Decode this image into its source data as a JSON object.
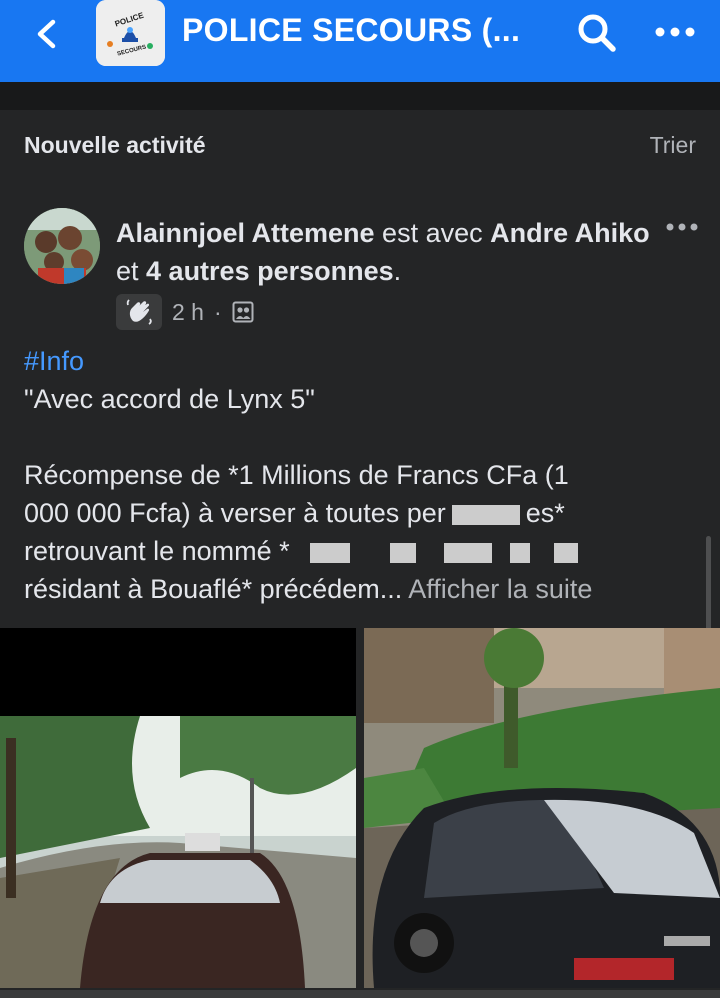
{
  "topbar": {
    "back_icon": "chevron-left-icon",
    "group_name": "POLICE SECOURS (...",
    "group_logo_text_1": "POLICE",
    "group_logo_text_2": "SECOURS",
    "search_icon": "search-icon",
    "more_icon": "more-horizontal-icon",
    "color": "#1877f2"
  },
  "section": {
    "title": "Nouvelle activité",
    "sort_label": "Trier"
  },
  "post": {
    "author": "Alainnjoel Attemene",
    "with_text": " est avec ",
    "tagged_1": "Andre Ahiko",
    "and_text": " et ",
    "others": "4 autres personnes",
    "period": ".",
    "time": "2 h",
    "separator": "·",
    "badge_icon": "wave-hand-icon",
    "audience_icon": "group-audience-icon",
    "hashtag": "#Info",
    "quote": "\"Avec accord de Lynx 5\"",
    "line_1": "Récompense de *1 Millions de Francs CFa (1",
    "line_2a": "000 000 Fcfa) à verser à toutes per",
    "line_2b": "es*",
    "line_3a": "retrouvant le nommé *",
    "line_4a": "résidant à Bouaflé* précédem...",
    "see_more": "Afficher la suite",
    "hashtag_color": "#4599ff"
  }
}
